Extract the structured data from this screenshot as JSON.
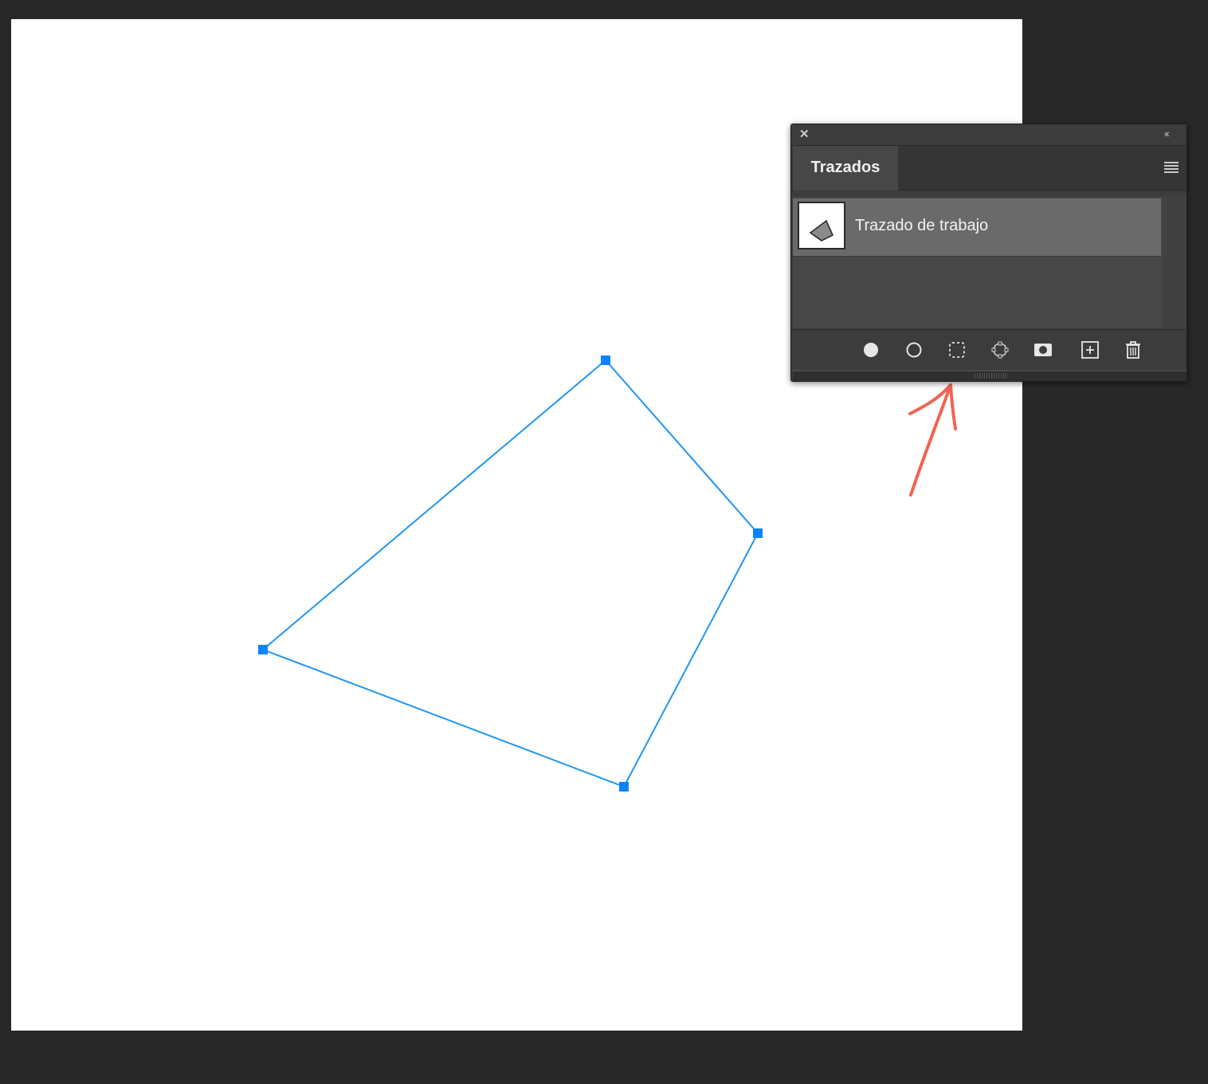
{
  "document": {
    "canvas_color": "#ffffff",
    "workspace_color": "#282828",
    "path_color": "#2196f3",
    "anchor_color": "#0a84ff"
  },
  "annotation": {
    "arrow_color": "#f06452"
  },
  "paths_panel": {
    "close_icon": "close-icon",
    "collapse_icon": "double-chevron-left-icon",
    "tab_label": "Trazados",
    "menu_icon": "hamburger-menu-icon",
    "selected_row_color": "#6a6a6a",
    "paths": [
      {
        "name": "Trazado de trabajo",
        "thumbnail_icon": "quadrilateral-path-thumbnail"
      }
    ],
    "toolbar": [
      {
        "icon": "fill-path-icon"
      },
      {
        "icon": "stroke-path-icon"
      },
      {
        "icon": "load-path-as-selection-icon"
      },
      {
        "icon": "make-work-path-from-selection-icon"
      },
      {
        "icon": "add-mask-icon"
      },
      {
        "icon": "create-new-path-icon"
      },
      {
        "icon": "delete-path-icon"
      }
    ]
  }
}
